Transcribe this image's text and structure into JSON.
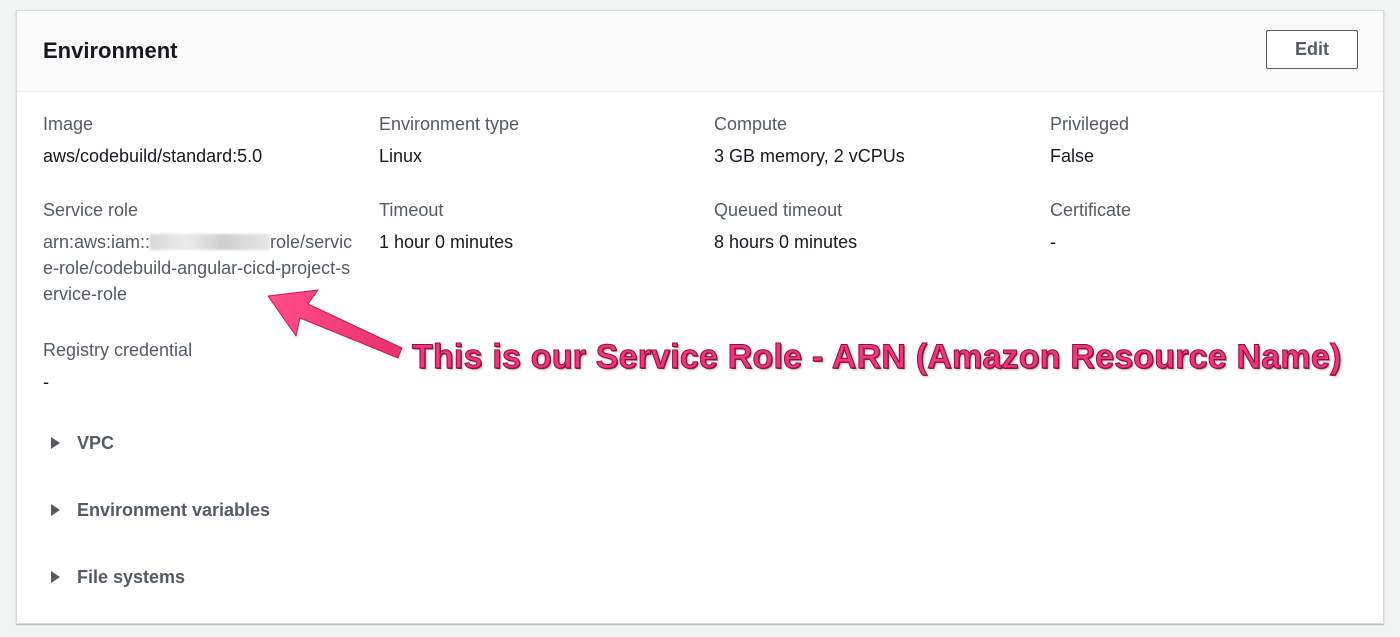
{
  "panel": {
    "title": "Environment",
    "edit_label": "Edit"
  },
  "fields": {
    "image": {
      "label": "Image",
      "value": "aws/codebuild/standard:5.0"
    },
    "environment_type": {
      "label": "Environment type",
      "value": "Linux"
    },
    "compute": {
      "label": "Compute",
      "value": "3 GB memory, 2 vCPUs"
    },
    "privileged": {
      "label": "Privileged",
      "value": "False"
    },
    "service_role": {
      "label": "Service role",
      "value_prefix": "arn:aws:iam::",
      "value_suffix": "role/service-role/codebuild-angular-cicd-project-service-role"
    },
    "timeout": {
      "label": "Timeout",
      "value": "1 hour 0 minutes"
    },
    "queued_timeout": {
      "label": "Queued timeout",
      "value": "8 hours 0 minutes"
    },
    "certificate": {
      "label": "Certificate",
      "value": "-"
    },
    "registry_credential": {
      "label": "Registry credential",
      "value": "-"
    }
  },
  "expanders": [
    {
      "label": "VPC"
    },
    {
      "label": "Environment variables"
    },
    {
      "label": "File systems"
    }
  ],
  "annotation": {
    "text": "This is our Service Role - ARN (Amazon Resource Name)",
    "color": "#f0367a"
  }
}
